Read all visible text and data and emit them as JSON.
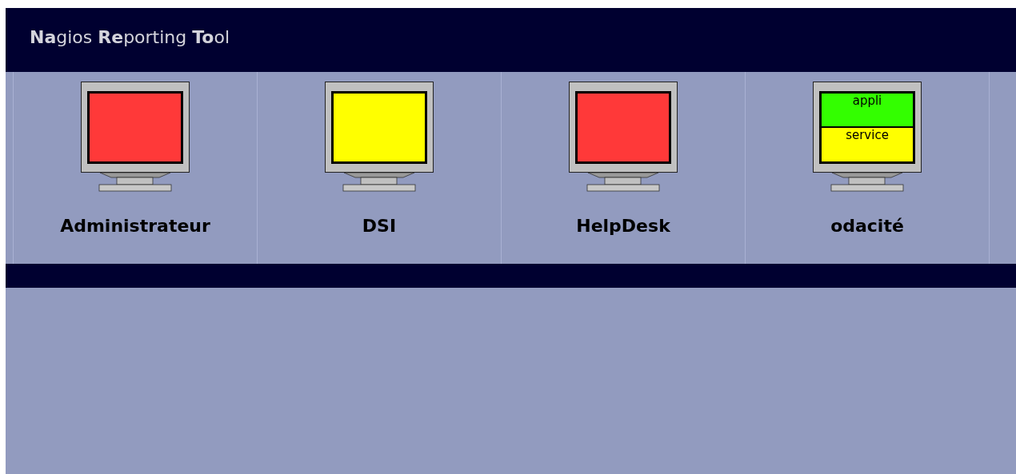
{
  "header": {
    "title": "**Na**gios **Re**porting **To**ol"
  },
  "tiles": [
    {
      "label": "Administrateur",
      "sections": [
        {
          "color": "#ff3939"
        }
      ]
    },
    {
      "label": "DSI",
      "sections": [
        {
          "color": "#ffff00"
        }
      ]
    },
    {
      "label": "HelpDesk",
      "sections": [
        {
          "color": "#ff3939"
        }
      ]
    },
    {
      "label": "odacité",
      "sections": [
        {
          "color": "#33ff00",
          "label": "appli"
        },
        {
          "color": "#ffff00",
          "label": "service"
        }
      ]
    }
  ]
}
